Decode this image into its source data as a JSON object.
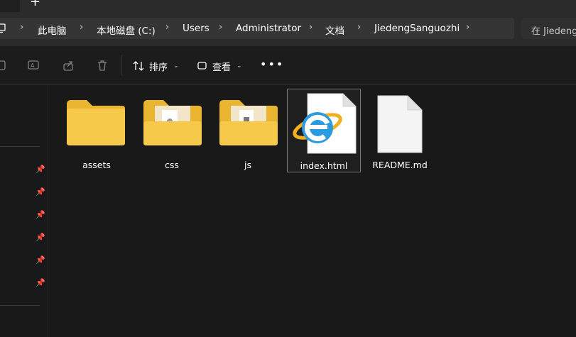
{
  "tabs": {
    "new_tab": "+"
  },
  "breadcrumb": [
    "此电脑",
    "本地磁盘 (C:)",
    "Users",
    "Administrator",
    "文档",
    "JiedengSanguozhi"
  ],
  "search": {
    "placeholder": "在 Jiedeng"
  },
  "toolbar": {
    "sort_label": "排序",
    "view_label": "查看",
    "more_label": "•••"
  },
  "files": [
    {
      "name": "assets",
      "type": "folder"
    },
    {
      "name": "css",
      "type": "folder"
    },
    {
      "name": "js",
      "type": "folder"
    },
    {
      "name": "index.html",
      "type": "html-file"
    },
    {
      "name": "README.md",
      "type": "file"
    }
  ],
  "colors": {
    "folder": "#f6c94a",
    "folder_back": "#e9b530",
    "background": "#191919",
    "selection_border": "#7a7a7a"
  }
}
